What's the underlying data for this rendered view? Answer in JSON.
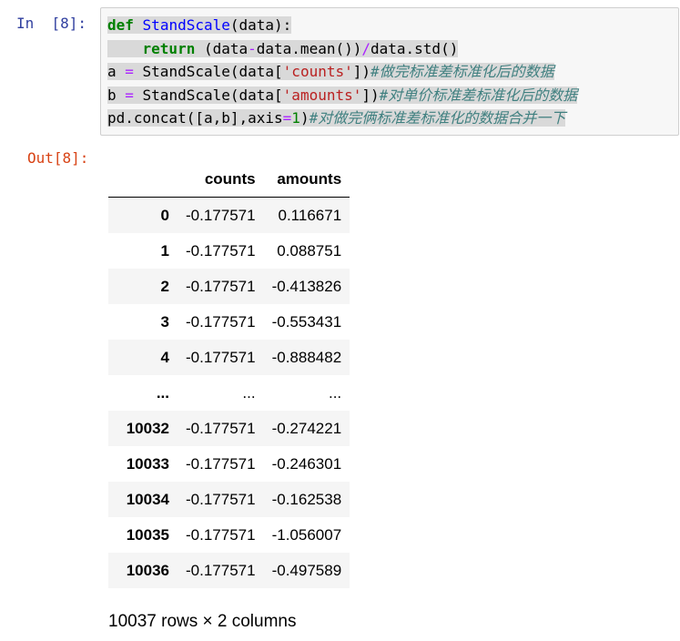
{
  "input_cell": {
    "prompt": "In  [8]:",
    "lines": [
      [
        {
          "t": "def",
          "c": "kw"
        },
        {
          "t": " ",
          "c": ""
        },
        {
          "t": "StandScale",
          "c": "fn"
        },
        {
          "t": "(data):",
          "c": ""
        }
      ],
      [
        {
          "t": "    ",
          "c": ""
        },
        {
          "t": "return",
          "c": "kw"
        },
        {
          "t": " (data",
          "c": ""
        },
        {
          "t": "-",
          "c": "op"
        },
        {
          "t": "data.mean())",
          "c": ""
        },
        {
          "t": "/",
          "c": "op"
        },
        {
          "t": "data.std()",
          "c": ""
        }
      ],
      [
        {
          "t": "a ",
          "c": ""
        },
        {
          "t": "=",
          "c": "op"
        },
        {
          "t": " StandScale(data[",
          "c": ""
        },
        {
          "t": "'counts'",
          "c": "str"
        },
        {
          "t": "])",
          "c": ""
        },
        {
          "t": "#做完标准差标准化后的数据",
          "c": "cmt"
        }
      ],
      [
        {
          "t": "b ",
          "c": ""
        },
        {
          "t": "=",
          "c": "op"
        },
        {
          "t": " StandScale(data[",
          "c": ""
        },
        {
          "t": "'amounts'",
          "c": "str"
        },
        {
          "t": "])",
          "c": ""
        },
        {
          "t": "#对单价标准差标准化后的数据",
          "c": "cmt"
        }
      ],
      [
        {
          "t": "pd.concat([a,b],axis",
          "c": ""
        },
        {
          "t": "=",
          "c": "op"
        },
        {
          "t": "1",
          "c": "num"
        },
        {
          "t": ")",
          "c": ""
        },
        {
          "t": "#对做完俩标准差标准化的数据合并一下",
          "c": "cmt"
        }
      ]
    ]
  },
  "output_cell": {
    "prompt": "Out[8]:",
    "table": {
      "columns": [
        "",
        "counts",
        "amounts"
      ],
      "rows": [
        {
          "index": "0",
          "counts": "-0.177571",
          "amounts": "0.116671"
        },
        {
          "index": "1",
          "counts": "-0.177571",
          "amounts": "0.088751"
        },
        {
          "index": "2",
          "counts": "-0.177571",
          "amounts": "-0.413826"
        },
        {
          "index": "3",
          "counts": "-0.177571",
          "amounts": "-0.553431"
        },
        {
          "index": "4",
          "counts": "-0.177571",
          "amounts": "-0.888482"
        },
        {
          "index": "...",
          "counts": "...",
          "amounts": "..."
        },
        {
          "index": "10032",
          "counts": "-0.177571",
          "amounts": "-0.274221"
        },
        {
          "index": "10033",
          "counts": "-0.177571",
          "amounts": "-0.246301"
        },
        {
          "index": "10034",
          "counts": "-0.177571",
          "amounts": "-0.162538"
        },
        {
          "index": "10035",
          "counts": "-0.177571",
          "amounts": "-1.056007"
        },
        {
          "index": "10036",
          "counts": "-0.177571",
          "amounts": "-0.497589"
        }
      ]
    },
    "shape": "10037 rows × 2 columns"
  }
}
